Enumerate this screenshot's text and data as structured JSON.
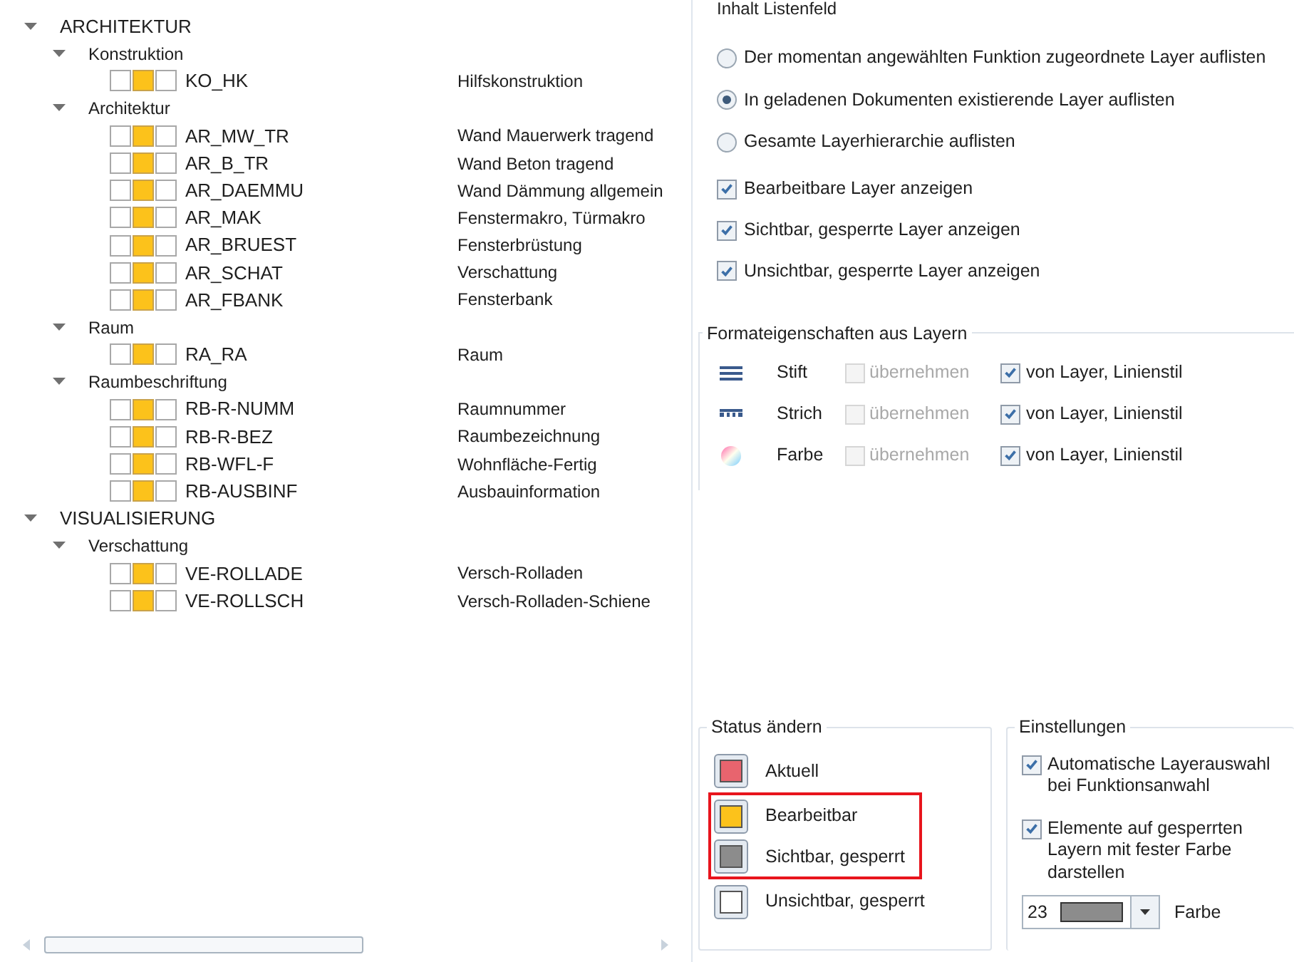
{
  "tree": [
    {
      "label": "ARCHITEKTUR",
      "expanded": true,
      "children": [
        {
          "label": "Konstruktion",
          "expanded": true,
          "children": [
            {
              "name": "KO_HK",
              "description": "Hilfskonstruktion"
            }
          ]
        },
        {
          "label": "Architektur",
          "expanded": true,
          "children": [
            {
              "name": "AR_MW_TR",
              "description": "Wand Mauerwerk tragend"
            },
            {
              "name": "AR_B_TR",
              "description": "Wand Beton tragend"
            },
            {
              "name": "AR_DAEMMU",
              "description": "Wand Dämmung allgemein"
            },
            {
              "name": "AR_MAK",
              "description": "Fenstermakro, Türmakro"
            },
            {
              "name": "AR_BRUEST",
              "description": "Fensterbrüstung"
            },
            {
              "name": "AR_SCHAT",
              "description": "Verschattung"
            },
            {
              "name": "AR_FBANK",
              "description": "Fensterbank"
            }
          ]
        },
        {
          "label": "Raum",
          "expanded": true,
          "children": [
            {
              "name": "RA_RA",
              "description": "Raum"
            }
          ]
        },
        {
          "label": "Raumbeschriftung",
          "expanded": true,
          "children": [
            {
              "name": "RB-R-NUMM",
              "description": "Raumnummer"
            },
            {
              "name": "RB-R-BEZ",
              "description": "Raumbezeichnung"
            },
            {
              "name": "RB-WFL-F",
              "description": "Wohnfläche-Fertig"
            },
            {
              "name": "RB-AUSBINF",
              "description": "Ausbauinformation"
            }
          ]
        }
      ]
    },
    {
      "label": "VISUALISIERUNG",
      "expanded": true,
      "children": [
        {
          "label": "Verschattung",
          "expanded": true,
          "children": [
            {
              "name": "VE-ROLLADE",
              "description": "Versch-Rolladen"
            },
            {
              "name": "VE-ROLLSCH",
              "description": "Versch-Rolladen-Schiene"
            }
          ]
        }
      ]
    }
  ],
  "list_content": {
    "title": "Inhalt Listenfeld",
    "radios": [
      {
        "label": "Der momentan angewählten Funktion zugeordnete Layer auflisten",
        "selected": false
      },
      {
        "label": "In geladenen Dokumenten existierende Layer auflisten",
        "selected": true
      },
      {
        "label": "Gesamte Layerhierarchie auflisten",
        "selected": false
      }
    ],
    "checkboxes": [
      {
        "label": "Bearbeitbare Layer anzeigen",
        "checked": true
      },
      {
        "label": "Sichtbar, gesperrte Layer anzeigen",
        "checked": true
      },
      {
        "label": "Unsichtbar, gesperrte Layer anzeigen",
        "checked": true
      }
    ]
  },
  "format": {
    "title": "Formateigenschaften aus Layern",
    "rows": [
      {
        "kind": "pen",
        "label": "Stift",
        "take": {
          "label": "übernehmen",
          "checked": false,
          "disabled": true
        },
        "from_layer": {
          "label": "von Layer, Linienstil",
          "checked": true
        }
      },
      {
        "kind": "line",
        "label": "Strich",
        "take": {
          "label": "übernehmen",
          "checked": false,
          "disabled": true
        },
        "from_layer": {
          "label": "von Layer, Linienstil",
          "checked": true
        }
      },
      {
        "kind": "color",
        "label": "Farbe",
        "take": {
          "label": "übernehmen",
          "checked": false,
          "disabled": true
        },
        "from_layer": {
          "label": "von Layer, Linienstil",
          "checked": true
        }
      }
    ]
  },
  "status": {
    "title": "Status ändern",
    "items": [
      {
        "label": "Aktuell",
        "color": "#e8646e",
        "highlighted": false
      },
      {
        "label": "Bearbeitbar",
        "color": "#fcc21b",
        "highlighted": true
      },
      {
        "label": "Sichtbar, gesperrt",
        "color": "#8c8c8c",
        "highlighted": true
      },
      {
        "label": "Unsichtbar, gesperrt",
        "color": "#ffffff",
        "highlighted": false
      }
    ]
  },
  "settings": {
    "title": "Einstellungen",
    "checkboxes": [
      {
        "label": "Automatische Layerauswahl bei Funktionsanwahl",
        "checked": true
      },
      {
        "label": "Elemente auf gesperrten Layern mit fester Farbe darstellen",
        "checked": true
      }
    ],
    "color_field": {
      "value": "23",
      "label": "Farbe"
    }
  }
}
